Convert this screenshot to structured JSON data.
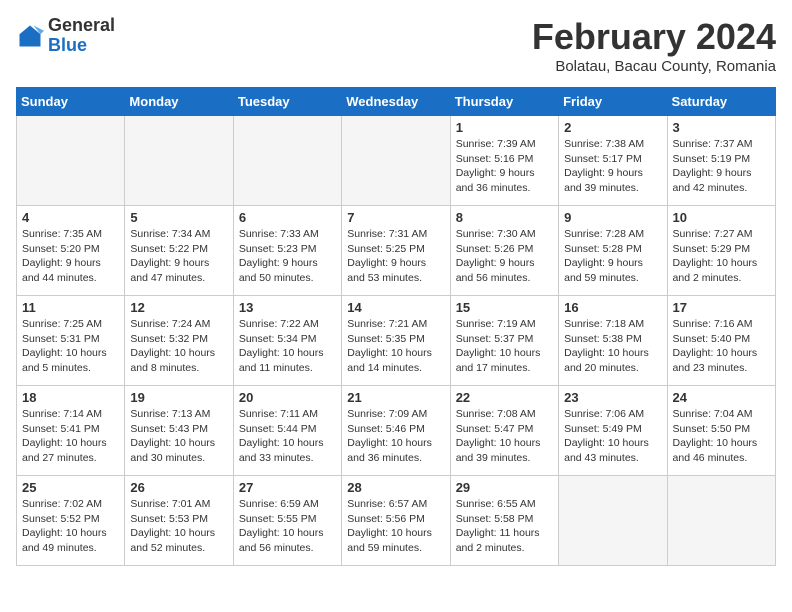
{
  "header": {
    "logo_general": "General",
    "logo_blue": "Blue",
    "title": "February 2024",
    "subtitle": "Bolatau, Bacau County, Romania"
  },
  "days_of_week": [
    "Sunday",
    "Monday",
    "Tuesday",
    "Wednesday",
    "Thursday",
    "Friday",
    "Saturday"
  ],
  "weeks": [
    [
      {
        "day": "",
        "info": "",
        "empty": true
      },
      {
        "day": "",
        "info": "",
        "empty": true
      },
      {
        "day": "",
        "info": "",
        "empty": true
      },
      {
        "day": "",
        "info": "",
        "empty": true
      },
      {
        "day": "1",
        "info": "Sunrise: 7:39 AM\nSunset: 5:16 PM\nDaylight: 9 hours\nand 36 minutes.",
        "empty": false
      },
      {
        "day": "2",
        "info": "Sunrise: 7:38 AM\nSunset: 5:17 PM\nDaylight: 9 hours\nand 39 minutes.",
        "empty": false
      },
      {
        "day": "3",
        "info": "Sunrise: 7:37 AM\nSunset: 5:19 PM\nDaylight: 9 hours\nand 42 minutes.",
        "empty": false
      }
    ],
    [
      {
        "day": "4",
        "info": "Sunrise: 7:35 AM\nSunset: 5:20 PM\nDaylight: 9 hours\nand 44 minutes.",
        "empty": false
      },
      {
        "day": "5",
        "info": "Sunrise: 7:34 AM\nSunset: 5:22 PM\nDaylight: 9 hours\nand 47 minutes.",
        "empty": false
      },
      {
        "day": "6",
        "info": "Sunrise: 7:33 AM\nSunset: 5:23 PM\nDaylight: 9 hours\nand 50 minutes.",
        "empty": false
      },
      {
        "day": "7",
        "info": "Sunrise: 7:31 AM\nSunset: 5:25 PM\nDaylight: 9 hours\nand 53 minutes.",
        "empty": false
      },
      {
        "day": "8",
        "info": "Sunrise: 7:30 AM\nSunset: 5:26 PM\nDaylight: 9 hours\nand 56 minutes.",
        "empty": false
      },
      {
        "day": "9",
        "info": "Sunrise: 7:28 AM\nSunset: 5:28 PM\nDaylight: 9 hours\nand 59 minutes.",
        "empty": false
      },
      {
        "day": "10",
        "info": "Sunrise: 7:27 AM\nSunset: 5:29 PM\nDaylight: 10 hours\nand 2 minutes.",
        "empty": false
      }
    ],
    [
      {
        "day": "11",
        "info": "Sunrise: 7:25 AM\nSunset: 5:31 PM\nDaylight: 10 hours\nand 5 minutes.",
        "empty": false
      },
      {
        "day": "12",
        "info": "Sunrise: 7:24 AM\nSunset: 5:32 PM\nDaylight: 10 hours\nand 8 minutes.",
        "empty": false
      },
      {
        "day": "13",
        "info": "Sunrise: 7:22 AM\nSunset: 5:34 PM\nDaylight: 10 hours\nand 11 minutes.",
        "empty": false
      },
      {
        "day": "14",
        "info": "Sunrise: 7:21 AM\nSunset: 5:35 PM\nDaylight: 10 hours\nand 14 minutes.",
        "empty": false
      },
      {
        "day": "15",
        "info": "Sunrise: 7:19 AM\nSunset: 5:37 PM\nDaylight: 10 hours\nand 17 minutes.",
        "empty": false
      },
      {
        "day": "16",
        "info": "Sunrise: 7:18 AM\nSunset: 5:38 PM\nDaylight: 10 hours\nand 20 minutes.",
        "empty": false
      },
      {
        "day": "17",
        "info": "Sunrise: 7:16 AM\nSunset: 5:40 PM\nDaylight: 10 hours\nand 23 minutes.",
        "empty": false
      }
    ],
    [
      {
        "day": "18",
        "info": "Sunrise: 7:14 AM\nSunset: 5:41 PM\nDaylight: 10 hours\nand 27 minutes.",
        "empty": false
      },
      {
        "day": "19",
        "info": "Sunrise: 7:13 AM\nSunset: 5:43 PM\nDaylight: 10 hours\nand 30 minutes.",
        "empty": false
      },
      {
        "day": "20",
        "info": "Sunrise: 7:11 AM\nSunset: 5:44 PM\nDaylight: 10 hours\nand 33 minutes.",
        "empty": false
      },
      {
        "day": "21",
        "info": "Sunrise: 7:09 AM\nSunset: 5:46 PM\nDaylight: 10 hours\nand 36 minutes.",
        "empty": false
      },
      {
        "day": "22",
        "info": "Sunrise: 7:08 AM\nSunset: 5:47 PM\nDaylight: 10 hours\nand 39 minutes.",
        "empty": false
      },
      {
        "day": "23",
        "info": "Sunrise: 7:06 AM\nSunset: 5:49 PM\nDaylight: 10 hours\nand 43 minutes.",
        "empty": false
      },
      {
        "day": "24",
        "info": "Sunrise: 7:04 AM\nSunset: 5:50 PM\nDaylight: 10 hours\nand 46 minutes.",
        "empty": false
      }
    ],
    [
      {
        "day": "25",
        "info": "Sunrise: 7:02 AM\nSunset: 5:52 PM\nDaylight: 10 hours\nand 49 minutes.",
        "empty": false
      },
      {
        "day": "26",
        "info": "Sunrise: 7:01 AM\nSunset: 5:53 PM\nDaylight: 10 hours\nand 52 minutes.",
        "empty": false
      },
      {
        "day": "27",
        "info": "Sunrise: 6:59 AM\nSunset: 5:55 PM\nDaylight: 10 hours\nand 56 minutes.",
        "empty": false
      },
      {
        "day": "28",
        "info": "Sunrise: 6:57 AM\nSunset: 5:56 PM\nDaylight: 10 hours\nand 59 minutes.",
        "empty": false
      },
      {
        "day": "29",
        "info": "Sunrise: 6:55 AM\nSunset: 5:58 PM\nDaylight: 11 hours\nand 2 minutes.",
        "empty": false
      },
      {
        "day": "",
        "info": "",
        "empty": true
      },
      {
        "day": "",
        "info": "",
        "empty": true
      }
    ]
  ]
}
